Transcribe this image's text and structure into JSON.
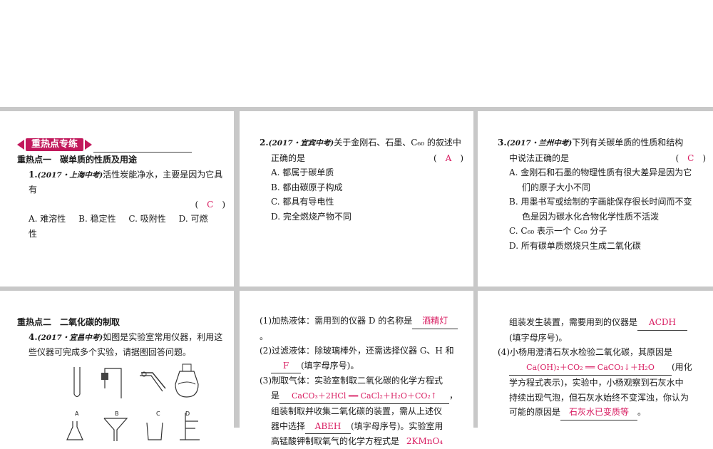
{
  "banner": "重热点专练",
  "p1": {
    "heading": "重热点一　碳单质的性质及用途",
    "q1_num": "1.",
    "q1_src": "(2017・上海中考)",
    "q1_text": "活性炭能净水，主要是因为它具有",
    "q1_ans": "C",
    "q1_options": [
      "A. 难溶性",
      "B. 稳定性",
      "C. 吸附性",
      "D. 可燃性"
    ]
  },
  "p2": {
    "q_num": "2.",
    "q_src": "(2017・宜宾中考)",
    "q_text_1": "关于金刚石、石墨、C₆₀ 的叙述中",
    "q_text_2": "正确的是",
    "q_ans": "A",
    "options": [
      "A. 都属于碳单质",
      "B. 都由碳原子构成",
      "C. 都具有导电性",
      "D. 完全燃烧产物不同"
    ]
  },
  "p3": {
    "q_num": "3.",
    "q_src": "(2017・兰州中考)",
    "q_text_1": "下列有关碳单质的性质和结构",
    "q_text_2": "中说法正确的是",
    "q_ans": "C",
    "opt_a_1": "A. 金刚石和石墨的物理性质有很大差异是因为它",
    "opt_a_2": "们的原子大小不同",
    "opt_b_1": "B. 用墨书写或绘制的字画能保存很长时间而不变",
    "opt_b_2": "色是因为碳水化合物化学性质不活泼",
    "opt_c": "C. C₆₀ 表示一个 C₆₀ 分子",
    "opt_d": "D. 所有碳单质燃烧只生成二氧化碳"
  },
  "p4": {
    "heading": "重热点二　二氧化碳的制取",
    "q4_num": "4.",
    "q4_src": "(2017・宜昌中考)",
    "q4_text_1": "如图是实验室常用仪器，利用这",
    "q4_text_2": "些仪器可完成多个实验，请据图回答问题。",
    "labels": [
      "A",
      "B",
      "C",
      "D"
    ]
  },
  "p5": {
    "l1a": "(1)加热液体：需用到的仪器 D 的名称是",
    "l1_ans": "酒精灯",
    "l1b": "。",
    "l2": "(2)过滤液体：除玻璃棒外，还需选择仪器 G、H 和",
    "l2_ans": "F",
    "l2b": "(填字母序号)。",
    "l3": "(3)制取气体：实验室制取二氧化碳的化学方程式",
    "l3a": "是",
    "l3_ans": "CaCO₃＋2HCl ══ CaCl₂＋H₂O＋CO₂↑",
    "l3b": "，",
    "l4": "组装制取并收集二氧化碳的装置，需从上述仪",
    "l5a": "器中选择",
    "l5_ans": "ABEH",
    "l5b": "(填字母序号)。实验室用",
    "l6a": "高锰酸钾制取氧气的化学方程式是",
    "l6_ans": "2KMnO₄"
  },
  "p6": {
    "l1a": "组装发生装置，需要用到的仪器是",
    "l1_ans": "ACDH",
    "l2": "(填字母序号)。",
    "l3": "(4)小杨用澄清石灰水检验二氧化碳，其原因是",
    "l4_ans": "Ca(OH)₂＋CO₂ ══ CaCO₃↓＋H₂O",
    "l4b": "(用化",
    "l5": "学方程式表示)，实验中，小杨观察到石灰水中",
    "l6": "持续出现气泡，但石灰水始终不变浑浊，你认为",
    "l7a": "可能的原因是",
    "l7_ans": "石灰水已变质等",
    "l7b": "。"
  }
}
